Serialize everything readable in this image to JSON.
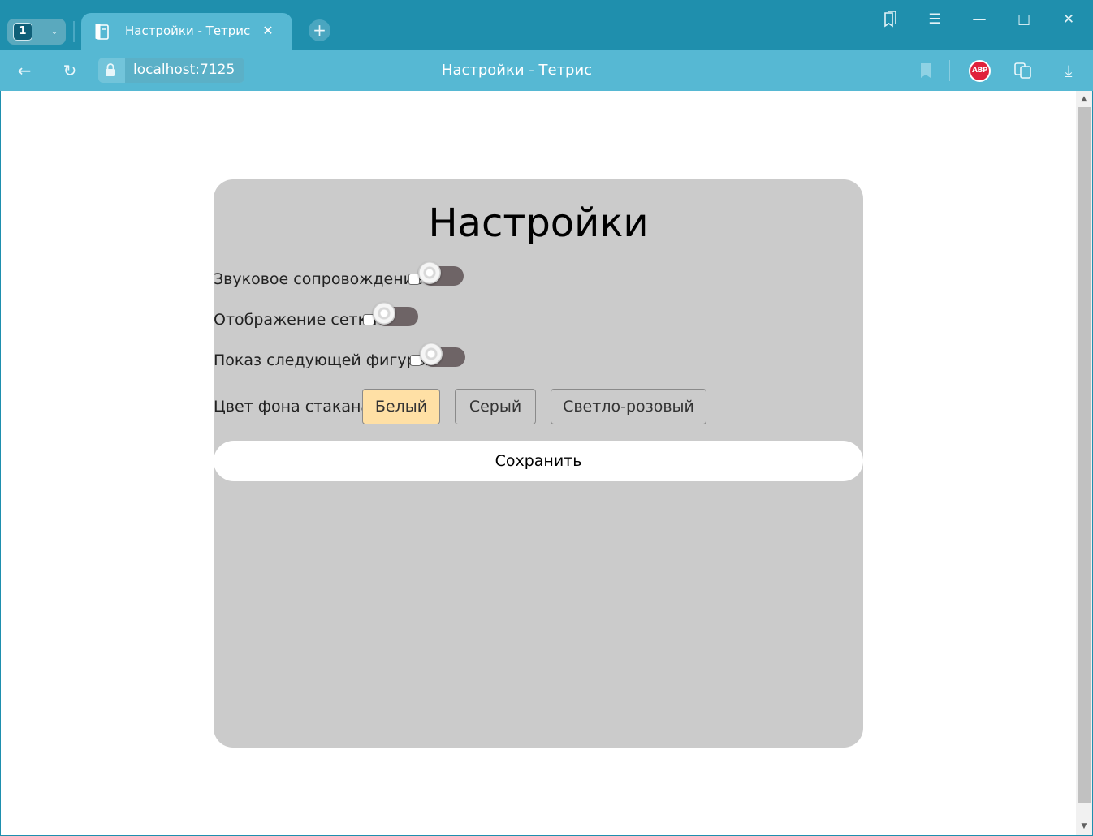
{
  "browser": {
    "tab_count": "1",
    "tab_title": "Настройки - Тетрис",
    "url": "localhost:7125",
    "page_title": "Настройки - Тетрис",
    "adblock_label": "ABP"
  },
  "settings": {
    "heading": "Настройки",
    "toggles": [
      {
        "label": "Звуковое сопровождение",
        "checked": false
      },
      {
        "label": "Отображение сетки",
        "checked": false
      },
      {
        "label": "Показ следующей фигуры",
        "checked": false
      }
    ],
    "background_color": {
      "label": "Цвет фона стакана:",
      "options": [
        "Белый",
        "Серый",
        "Светло-розовый"
      ],
      "selected": "Белый"
    },
    "save_label": "Сохранить"
  },
  "colors": {
    "tabstrip": "#1f8fad",
    "toolbar": "#56b8d3",
    "card": "#cbcbcb",
    "selected_option": "#ffe0a5",
    "toggle_track": "#6e6466"
  }
}
